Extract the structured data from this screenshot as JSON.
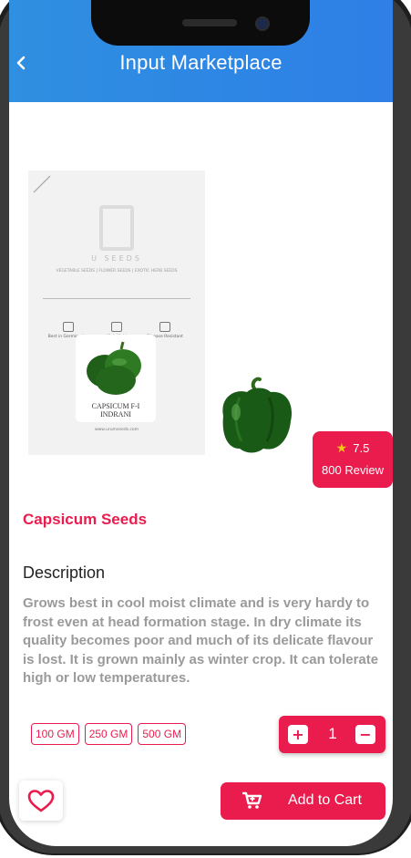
{
  "header": {
    "title": "Input Marketplace",
    "back_icon": "chevron-left-icon"
  },
  "product": {
    "name": "Capsicum Seeds",
    "rating": "7.5",
    "reviews": "800 Review",
    "description_heading": "Description",
    "description": "Grows best in cool moist climate and is very hardy to frost even at head formation stage. In dry climate its quality becomes poor and much of its delicate flavour is lost. It is grown mainly as winter crop. It can tolerate high or low temperatures."
  },
  "package": {
    "brand": "U   SEEDS",
    "subtitle": "VEGETABLE SEEDS | FLOWER SEEDS | EXOTIC HERB SEEDS",
    "features": [
      "Best in Germination",
      "High Yield",
      "Disease Resistant"
    ],
    "variety_line1": "CAPSICUM F-I",
    "variety_line2": "INDRANI",
    "url": "www.urumseeds.com"
  },
  "sizes": [
    "100 GM",
    "250 GM",
    "500 GM"
  ],
  "quantity": {
    "value": "1",
    "plus": "+",
    "minus": "−"
  },
  "actions": {
    "add_to_cart": "Add to Cart",
    "favorite_icon": "heart-icon",
    "cart_icon": "cart-icon"
  },
  "colors": {
    "accent": "#e91c4d",
    "header": "#2e86e4",
    "star": "#f5c518"
  }
}
